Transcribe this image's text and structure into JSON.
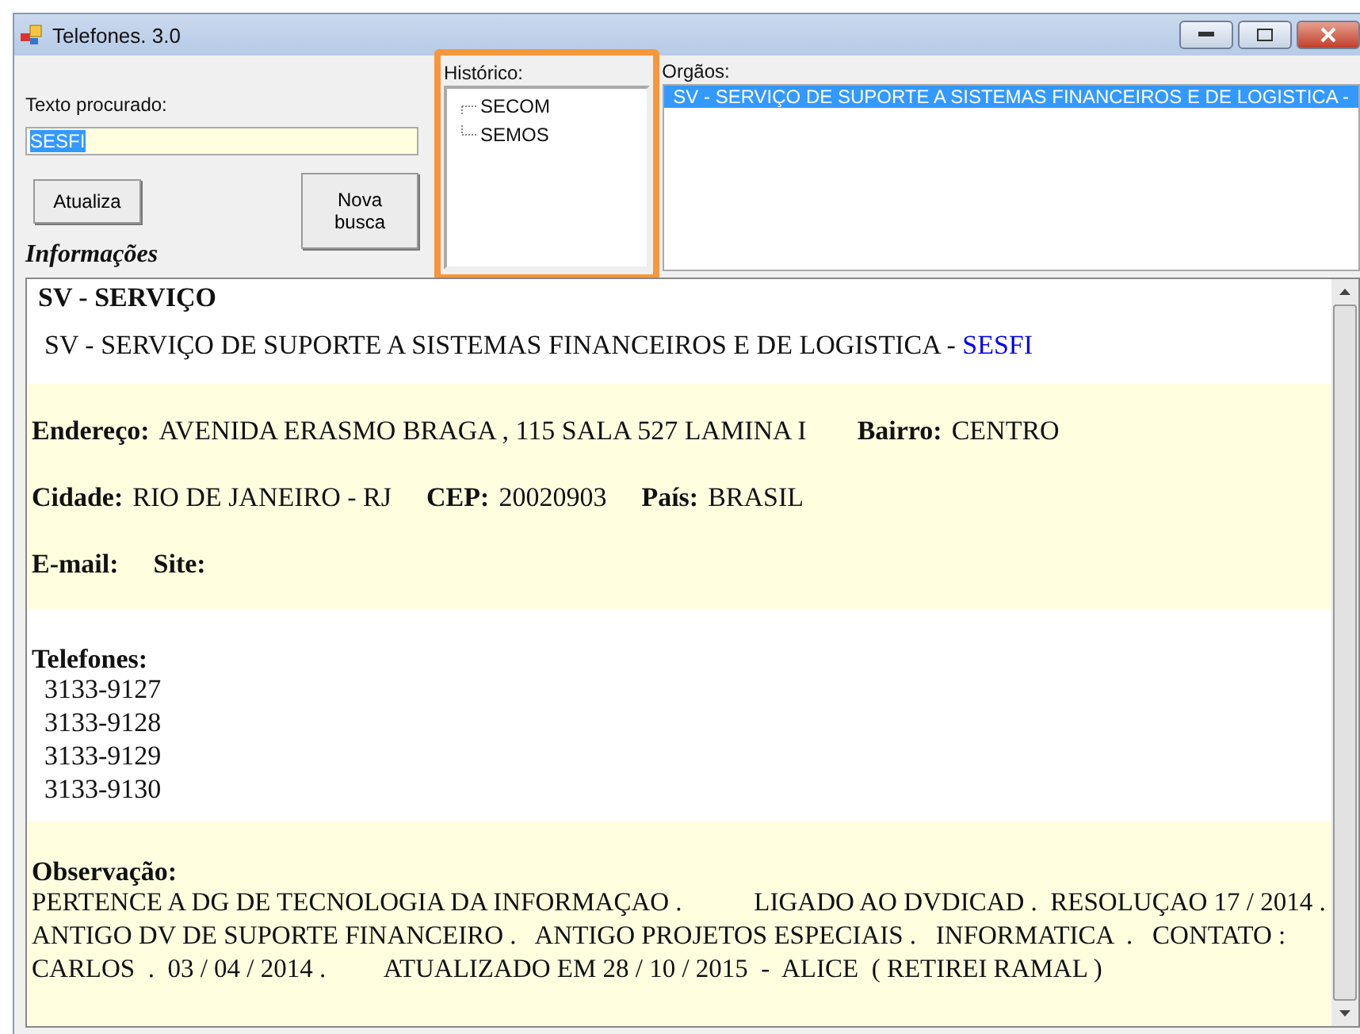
{
  "window": {
    "title": "Telefones. 3.0"
  },
  "search": {
    "label": "Texto procurado:",
    "value": "SESFI",
    "text_selected": true
  },
  "buttons": [
    {
      "label": "Atualiza",
      "kind": "small"
    },
    {
      "label": "Nova busca",
      "kind": "tall"
    }
  ],
  "history": {
    "label": "Histórico:",
    "highlighted": true,
    "items": [
      {
        "label": "SECOM"
      },
      {
        "label": "SEMOS"
      }
    ]
  },
  "organs": {
    "label": "Orgãos:",
    "items": [
      {
        "label": "SV - SERVIÇO DE SUPORTE A SISTEMAS FINANCEIROS E DE LOGISTICA -",
        "selected": true
      }
    ]
  },
  "info": {
    "heading": "Informações",
    "title": "SV - SERVIÇO",
    "full_name": "SV - SERVIÇO DE SUPORTE A SISTEMAS FINANCEIROS E DE LOGISTICA - ",
    "acronym": "SESFI",
    "address_rows": [
      [
        {
          "label": "Endereço:",
          "value": "AVENIDA ERASMO BRAGA , 115 SALA 527 LAMINA I"
        },
        {
          "label": "Bairro:",
          "value": "CENTRO"
        }
      ],
      [
        {
          "label": "Cidade:",
          "value": "RIO DE JANEIRO - RJ"
        },
        {
          "label": "CEP:",
          "value": "20020903"
        },
        {
          "label": "País:",
          "value": "BRASIL"
        }
      ],
      [
        {
          "label": "E-mail:"
        },
        {
          "label": "Site:"
        }
      ]
    ],
    "phones_label": "Telefones:",
    "phones": [
      "3133-9127",
      "3133-9128",
      "3133-9129",
      "3133-9130"
    ],
    "notes_label": "Observação:",
    "notes": "PERTENCE A DG DE TECNOLOGIA DA INFORMAÇAO .           LIGADO AO DVDICAD .  RESOLUÇAO 17 / 2014 .    ANTIGO DV DE SUPORTE FINANCEIRO .   ANTIGO PROJETOS ESPECIAIS .   INFORMATICA  .   CONTATO :  CARLOS  .  03 / 04 / 2014 .         ATUALIZADO EM 28 / 10 / 2015  -  ALICE  ( RETIREI RAMAL )"
  }
}
